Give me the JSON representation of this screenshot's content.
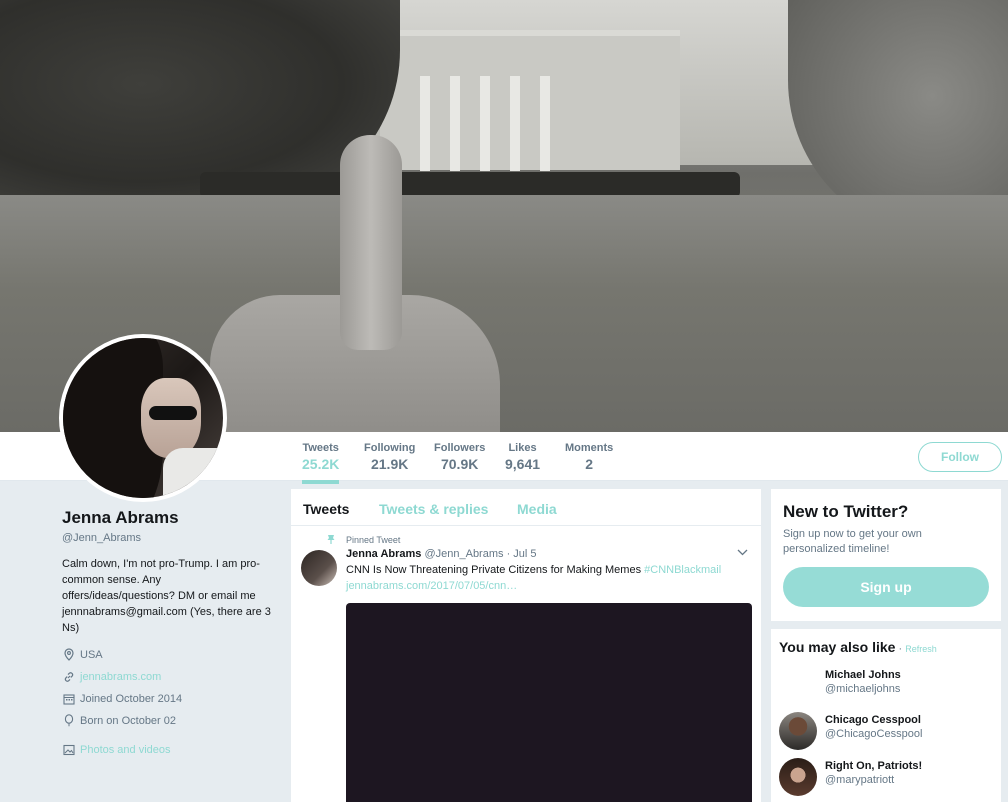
{
  "stats": [
    {
      "label": "Tweets",
      "value": "25.2K",
      "active": true
    },
    {
      "label": "Following",
      "value": "21.9K"
    },
    {
      "label": "Followers",
      "value": "70.9K"
    },
    {
      "label": "Likes",
      "value": "9,641"
    },
    {
      "label": "Moments",
      "value": "2"
    }
  ],
  "follow_label": "Follow",
  "profile": {
    "name": "Jenna Abrams",
    "handle": "@Jenn_Abrams",
    "bio": "Calm down, I'm not pro-Trump. I am pro-common sense. Any offers/ideas/questions? DM or email me jennnabrams@gmail.com (Yes, there are 3 Ns)",
    "location": "USA",
    "website": "jennabrams.com",
    "joined": "Joined October 2014",
    "born": "Born on October 02",
    "photos": "Photos and videos"
  },
  "tabs": [
    "Tweets",
    "Tweets & replies",
    "Media"
  ],
  "tweet": {
    "pinned_label": "Pinned Tweet",
    "author": "Jenna Abrams",
    "handle": "@Jenn_Abrams",
    "date": "· Jul 5",
    "text": "CNN Is Now Threatening Private Citizens for Making Memes",
    "hashtag": "#CNNBlackmail",
    "link": "jennabrams.com/2017/07/05/cnn…"
  },
  "signup": {
    "title": "New to Twitter?",
    "subtitle": "Sign up now to get your own personalized timeline!",
    "button": "Sign up"
  },
  "suggestions": {
    "title": "You may also like",
    "separator": " · ",
    "refresh": "Refresh",
    "items": [
      {
        "name": "Michael Johns",
        "handle": "@michaeljohns"
      },
      {
        "name": "Chicago Cesspool",
        "handle": "@ChicagoCesspool"
      },
      {
        "name": "Right On, Patriots!",
        "handle": "@marypatriott"
      }
    ]
  },
  "colors": {
    "accent": "#8ed9d2",
    "muted": "#657786",
    "background": "#e6ecf0"
  },
  "icons": [
    "map-pin-icon",
    "link-icon",
    "calendar-icon",
    "balloon-icon",
    "photo-icon",
    "pin-icon",
    "chevron-down-icon"
  ]
}
